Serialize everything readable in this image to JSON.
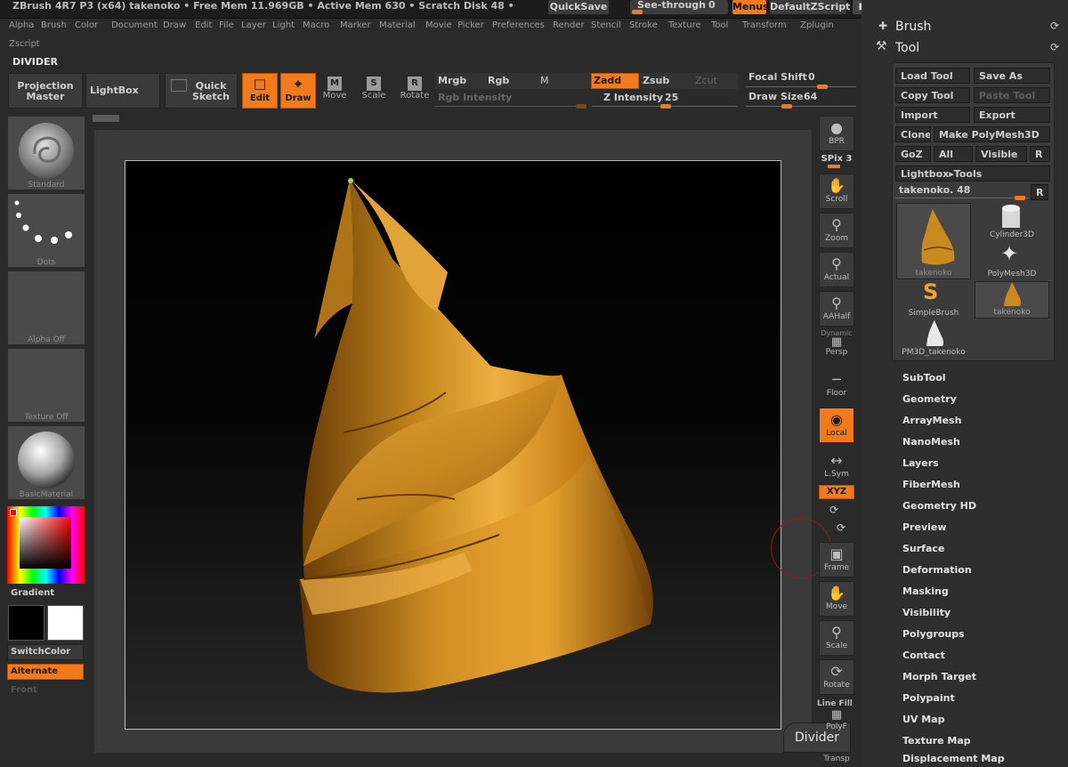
{
  "top_bar": {
    "status": "ZBrush 4R7 P3 (x64)   takenoko   • Free Mem 11.969GB • Active Mem 630 • Scratch Disk 48 •",
    "quicksave": "QuickSave",
    "see_through": "See-through",
    "see_through_value": "0",
    "menus": "Menus",
    "default_zscript": "DefaultZScript"
  },
  "menu_bar": [
    "Alpha",
    "Brush",
    "Color",
    "Document",
    "Draw",
    "Edit",
    "File",
    "Layer",
    "Light",
    "Macro",
    "Marker",
    "Material",
    "Movie",
    "Picker",
    "Preferences",
    "Render",
    "Stencil",
    "Stroke",
    "Texture",
    "Tool",
    "Transform",
    "Zplugin"
  ],
  "zscript": "Zscript",
  "divider_title": "DIVIDER",
  "toolbar": {
    "projection_master": "Projection Master",
    "lightbox": "LightBox",
    "quick_sketch": "Quick Sketch",
    "edit": "Edit",
    "draw": "Draw",
    "move": "Move",
    "scale": "Scale",
    "rotate": "Rotate",
    "mrgb": "Mrgb",
    "rgb": "Rgb",
    "m": "M",
    "zadd": "Zadd",
    "zsub": "Zsub",
    "zcut": "Zcut",
    "rgb_intensity": "Rgb Intensity",
    "z_intensity_label": "Z Intensity",
    "z_intensity_value": "25",
    "focal_shift_label": "Focal Shift",
    "focal_shift_value": "0",
    "draw_size_label": "Draw Size",
    "draw_size_value": "64"
  },
  "left_panel": {
    "brush": "Standard",
    "stroke": "Dots",
    "alpha": "Alpha Off",
    "texture": "Texture Off",
    "material": "BasicMaterial",
    "gradient": "Gradient",
    "switchcolor": "SwitchColor",
    "alternate": "Alternate",
    "front": "Front"
  },
  "right_shelf": {
    "bpr": "BPR",
    "spix_label": "SPix",
    "spix_value": "3",
    "scroll": "Scroll",
    "zoom": "Zoom",
    "actual": "Actual",
    "aahalf": "AAHalf",
    "dynamic": "Dynamic",
    "persp": "Persp",
    "floor": "Floor",
    "local": "Local",
    "lsym": "L.Sym",
    "xyz": "XYZ",
    "frame": "Frame",
    "move": "Move",
    "scale": "Scale",
    "rotate": "Rotate",
    "line_fill": "Line Fill",
    "polyf": "PolyF",
    "transp": "Transp"
  },
  "divider_tooltip": "Divider",
  "right_panel": {
    "brush_header": "Brush",
    "tool_header": "Tool",
    "load_tool": "Load Tool",
    "save_as": "Save As",
    "copy_tool": "Copy Tool",
    "paste_tool": "Paste Tool",
    "import": "Import",
    "export": "Export",
    "clone": "Clone",
    "make_polymesh": "Make PolyMesh3D",
    "goz": "GoZ",
    "all": "All",
    "visible": "Visible",
    "r": "R",
    "lightbox_tools": "Lightbox▸Tools",
    "current_tool": "takenoko. 48",
    "thumbs": {
      "main": "takenoko",
      "cylinder": "Cylinder3D",
      "polymesh": "PolyMesh3D",
      "simplebrush": "SimpleBrush",
      "takenoko_small": "takenoko",
      "pm3d": "PM3D_takenoko"
    },
    "submenus": [
      "SubTool",
      "Geometry",
      "ArrayMesh",
      "NanoMesh",
      "Layers",
      "FiberMesh",
      "Geometry HD",
      "Preview",
      "Surface",
      "Deformation",
      "Masking",
      "Visibility",
      "Polygroups",
      "Contact",
      "Morph Target",
      "Polypaint",
      "UV Map",
      "Texture Map",
      "Displacement Map"
    ]
  },
  "colors": {
    "accent": "#f27a1a",
    "background": "#2a2a2a",
    "mesh": "#c9891c"
  }
}
